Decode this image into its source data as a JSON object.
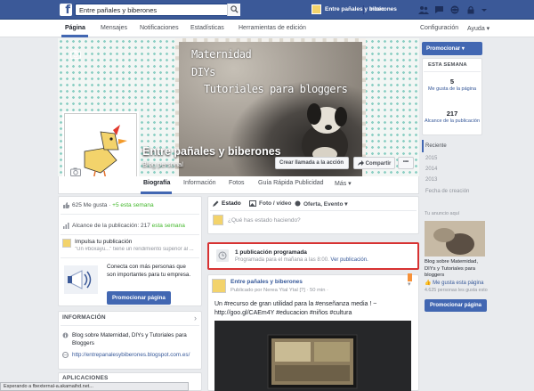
{
  "topbar": {
    "search_value": "Entre pañales y biberones",
    "page_name": "Entre pañales y biberones",
    "home_label": "Inicio",
    "brand_color": "#3b5998"
  },
  "pagenav": {
    "tabs": [
      "Página",
      "Mensajes",
      "Notificaciones",
      "Estadísticas",
      "Herramientas de edición"
    ],
    "settings": "Configuración",
    "help": "Ayuda"
  },
  "cover": {
    "text_lines": [
      "Maternidad",
      "DIYs",
      "Tutoriales para bloggers"
    ],
    "page_title": "Entre pañales y biberones",
    "category": "Blog personal",
    "call_button": "Crear llamada a la acción",
    "share_button": "Compartir",
    "more_button": "•••"
  },
  "timeline_tabs": [
    "Biografía",
    "Información",
    "Fotos",
    "Guía Rápida Publicidad",
    "Más"
  ],
  "left": {
    "likes_text": "625 Me gusta",
    "likes_new": "+5 esta semana",
    "reach_text": "Alcance de la publicación: 217",
    "reach_period": "esta semana",
    "promo_title": "Impulsa tu publicación",
    "promo_snippet": "\"Un #boxayu...\" tiene un rendimiento superior al ...",
    "connect_text": "Conecta con más personas que son importantes para tu empresa.",
    "promote_button": "Promocionar página",
    "info_header": "INFORMACIÓN",
    "info_desc": "Blog sobre Maternidad, DIYs y Tutoriales para Bloggers",
    "info_url": "http://entrepanalesybiberones.blogspot.com.es/",
    "apps_header": "APLICACIONES"
  },
  "composer": {
    "tabs": [
      "Estado",
      "Foto / vídeo",
      "Oferta, Evento"
    ],
    "placeholder": "¿Qué has estado haciendo?"
  },
  "scheduled": {
    "title": "1 publicación programada",
    "subtitle": "Programada para el mañana a las 8:00.",
    "link": "Ver publicación."
  },
  "post": {
    "author": "Entre pañales y biberones",
    "meta": "Publicado por Nerea Ytal Ytal [?] · 50 min ·",
    "text": "Un #recurso de gran utilidad para la #enseñanza media ! ~ http://goo.gl/CAEm4Y #educacion #niños #cultura",
    "hashtag_color": "#365899"
  },
  "rightbar": {
    "promote_button": "Promocionar",
    "week_header": "ESTA SEMANA",
    "stats": [
      {
        "value": "5",
        "label": "Me gusta de la página"
      },
      {
        "value": "217",
        "label": "Alcance de la publicación"
      }
    ],
    "years": [
      "Reciente",
      "2015",
      "2014",
      "2013",
      "Fecha de creación"
    ]
  },
  "ad": {
    "header": "Tu anuncio aquí",
    "description": "Blog sobre Maternidad, DIYs y Tutoriales para bloggers",
    "like": "Me gusta esta página",
    "likes_count": "4.625 personas les gusta esto",
    "button": "Promocionar página"
  },
  "statusbar": "Esperando a fbexternal-a.akamaihd.net..."
}
